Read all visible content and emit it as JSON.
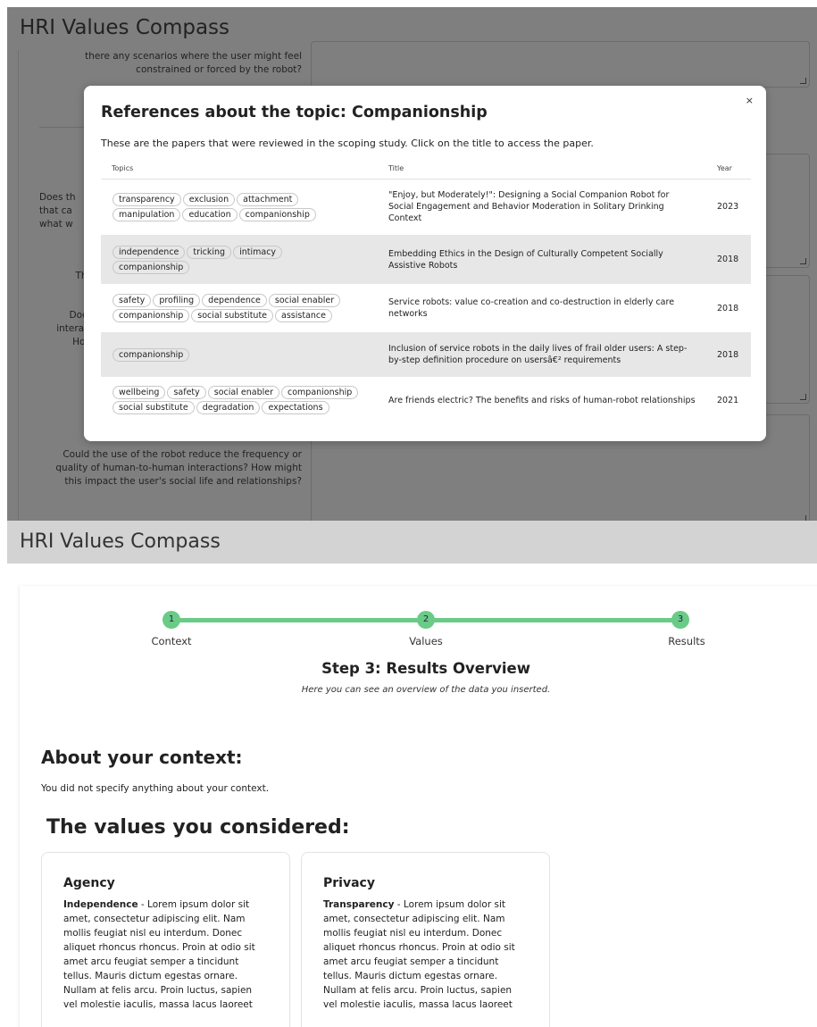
{
  "app_title": "HRI Values Compass",
  "background_questions": [
    "there any scenarios where the user might feel constrained or forced by the robot?",
    "Does the robot provide features that can...",
    "The...",
    "Does... interact... How...",
    "Could the use of the robot reduce the frequency or quality of human-to-human interactions? How might this impact the user's social life and relationships?"
  ],
  "modal": {
    "close": "×",
    "title": "References about the topic: Companionship",
    "description": "These are the papers that were reviewed in the scoping study. Click on the title to access the paper.",
    "columns": [
      "Topics",
      "Title",
      "Year"
    ],
    "rows": [
      {
        "topics": [
          "transparency",
          "exclusion",
          "attachment",
          "manipulation",
          "education",
          "companionship"
        ],
        "title": "\"Enjoy, but Moderately!\": Designing a Social Companion Robot for Social Engagement and Behavior Moderation in Solitary Drinking Context",
        "year": "2023"
      },
      {
        "topics": [
          "independence",
          "tricking",
          "intimacy",
          "companionship"
        ],
        "title": "Embedding Ethics in the Design of Culturally Competent Socially Assistive Robots",
        "year": "2018"
      },
      {
        "topics": [
          "safety",
          "profiling",
          "dependence",
          "social enabler",
          "companionship",
          "social substitute",
          "assistance"
        ],
        "title": "Service robots: value co-creation and co-destruction in elderly care networks",
        "year": "2018"
      },
      {
        "topics": [
          "companionship"
        ],
        "title": "Inclusion of service robots in the daily lives of frail older users: A step-by-step definition procedure on usersâ€² requirements",
        "year": "2018"
      },
      {
        "topics": [
          "wellbeing",
          "safety",
          "social enabler",
          "companionship",
          "social substitute",
          "degradation",
          "expectations"
        ],
        "title": "Are friends electric? The benefits and risks of human-robot relationships",
        "year": "2021"
      }
    ]
  },
  "results": {
    "steps": [
      {
        "num": "1",
        "label": "Context"
      },
      {
        "num": "2",
        "label": "Values"
      },
      {
        "num": "3",
        "label": "Results"
      }
    ],
    "step_title": "Step 3: Results Overview",
    "step_subtitle": "Here you can see an overview of the data you inserted.",
    "about_heading": "About your context:",
    "about_text": "You did not specify anything about your context.",
    "values_heading": "The values you considered:",
    "value_cards": [
      {
        "heading": "Agency",
        "term": "Independence",
        "text": " - Lorem ipsum dolor sit amet, consectetur adipiscing elit. Nam mollis feugiat nisl eu interdum. Donec aliquet rhoncus rhoncus. Proin at odio sit amet arcu feugiat semper a tincidunt tellus. Mauris dictum egestas ornare. Nullam at felis arcu. Proin luctus, sapien vel molestie iaculis, massa lacus laoreet"
      },
      {
        "heading": "Privacy",
        "term": "Transparency",
        "text": " - Lorem ipsum dolor sit amet, consectetur adipiscing elit. Nam mollis feugiat nisl eu interdum. Donec aliquet rhoncus rhoncus. Proin at odio sit amet arcu feugiat semper a tincidunt tellus. Mauris dictum egestas ornare. Nullam at felis arcu. Proin luctus, sapien vel molestie iaculis, massa lacus laoreet"
      }
    ],
    "accent_color": "#6acb86"
  }
}
